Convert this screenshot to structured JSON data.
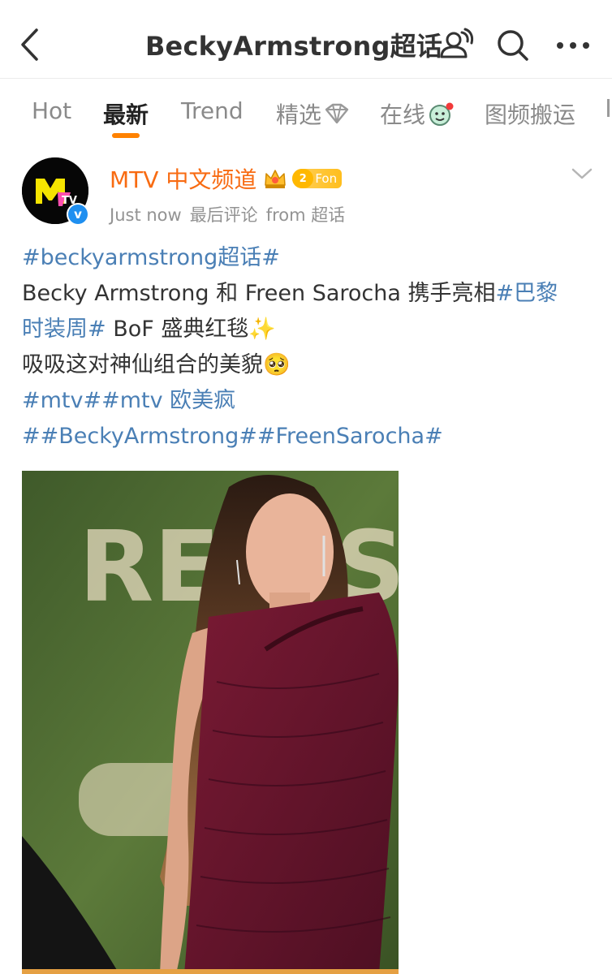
{
  "header": {
    "title": "BeckyArmstrong超话",
    "icons": [
      "back-arrow-icon",
      "chat-users-icon",
      "search-icon",
      "more-icon"
    ]
  },
  "tabs": [
    {
      "label": "Hot",
      "active": false
    },
    {
      "label": "最新",
      "active": true
    },
    {
      "label": "Trend",
      "active": false
    },
    {
      "label": "精选",
      "active": false,
      "icon": "sparkle-badge-icon"
    },
    {
      "label": "在线",
      "active": false,
      "icon": "online-emoji-icon"
    },
    {
      "label": "图频搬运",
      "active": false
    }
  ],
  "post": {
    "author": "MTV 中文频道",
    "fan_level": "2",
    "fan_label": "Fon",
    "time": "Just now",
    "status": "最后评论",
    "source": "from 超话",
    "lines": [
      [
        {
          "t": "#beckyarmstrong超话#",
          "tag": true
        }
      ],
      [
        {
          "t": "Becky Armstrong 和 Freen Sarocha 携手亮相",
          "tag": false
        },
        {
          "t": "#巴黎",
          "tag": true
        }
      ],
      [
        {
          "t": "时装周#",
          "tag": true
        },
        {
          "t": " BoF 盛典红毯",
          "tag": false
        },
        {
          "t": "✨",
          "tag": false
        }
      ],
      [
        {
          "t": "吸吸这对神仙组合的美貌",
          "tag": false
        },
        {
          "t": "🥺",
          "tag": false
        }
      ],
      [
        {
          "t": "#mtv##mtv 欧美疯",
          "tag": true
        }
      ],
      [
        {
          "t": "##BeckyArmstrong##FreenSarocha#",
          "tag": true
        }
      ]
    ],
    "photo_text": "RED SEA FF"
  },
  "colors": {
    "accent": "#ff8200",
    "author": "#f86b12",
    "link": "#4a7fb5",
    "muted": "#939393",
    "dress": "#6e1730"
  }
}
